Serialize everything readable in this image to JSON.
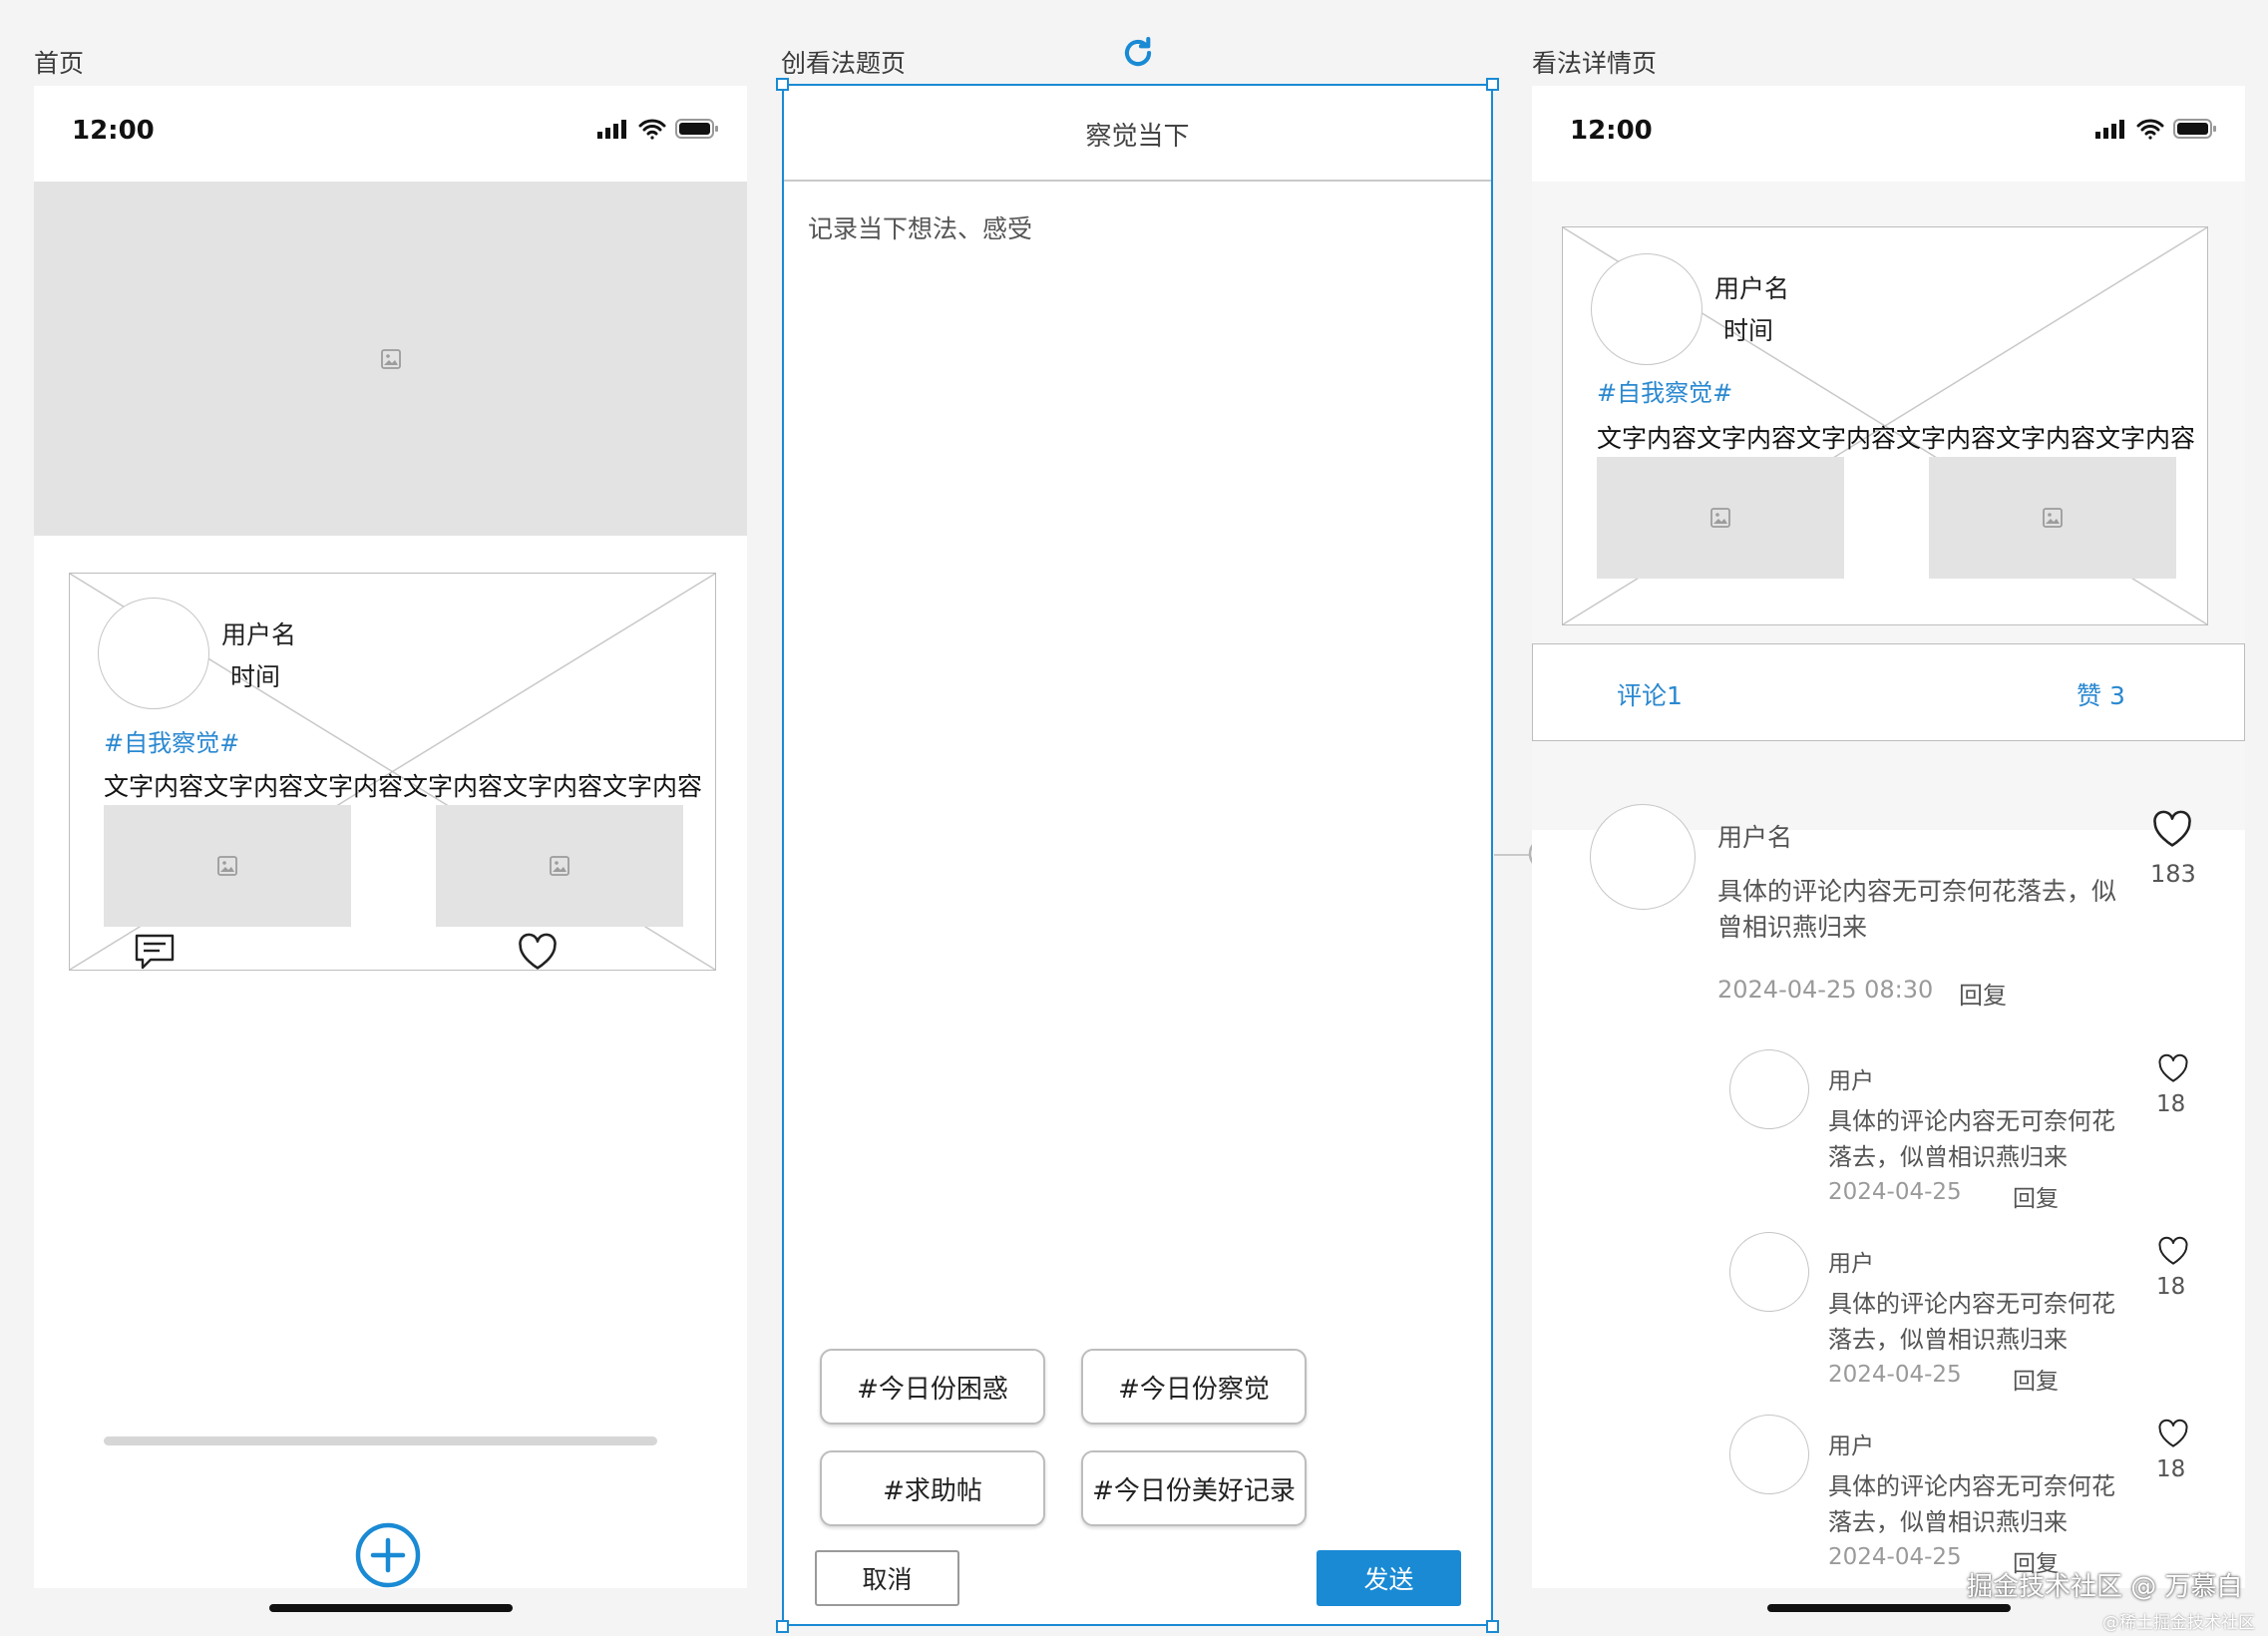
{
  "labels": {
    "home": "首页",
    "create": "创看法题页",
    "detail": "看法详情页"
  },
  "status_bar": {
    "time": "12:00"
  },
  "home": {
    "card": {
      "username": "用户名",
      "time": "时间",
      "tag": "#自我察觉#",
      "content": "文字内容文字内容文字内容文字内容文字内容文字内容"
    }
  },
  "create": {
    "title": "察觉当下",
    "placeholder": "记录当下想法、感受",
    "tags": [
      "#今日份困惑",
      "#今日份察觉",
      "#求助帖",
      "#今日份美好记录"
    ],
    "cancel_label": "取消",
    "send_label": "发送"
  },
  "detail": {
    "card": {
      "username": "用户名",
      "time": "时间",
      "tag": "#自我察觉#",
      "content": "文字内容文字内容文字内容文字内容文字内容文字内容"
    },
    "tabs": {
      "comments": "评论1",
      "likes": "赞 3"
    },
    "comment": {
      "username": "用户名",
      "line1": "具体的评论内容无可奈何花落去，似",
      "line2": "曾相识燕归来",
      "date": "2024-04-25 08:30",
      "reply": "回复",
      "likes": "183"
    },
    "replies": [
      {
        "username": "用户",
        "line1": "具体的评论内容无可奈何花",
        "line2": "落去，似曾相识燕归来",
        "date": "2024-04-25",
        "reply": "回复",
        "likes": "18"
      },
      {
        "username": "用户",
        "line1": "具体的评论内容无可奈何花",
        "line2": "落去，似曾相识燕归来",
        "date": "2024-04-25",
        "reply": "回复",
        "likes": "18"
      },
      {
        "username": "用户",
        "line1": "具体的评论内容无可奈何花",
        "line2": "落去，似曾相识燕归来",
        "date": "2024-04-25",
        "reply": "回复",
        "likes": "18"
      }
    ]
  },
  "watermark": {
    "main": "掘金技术社区 @ 万慕白",
    "small": "@稀土掘金技术社区"
  },
  "colors": {
    "accent": "#1a8ad4",
    "tag": "#2a88d0",
    "send_button": "#1a8ad4",
    "placeholder_gray": "#e3e3e3"
  }
}
